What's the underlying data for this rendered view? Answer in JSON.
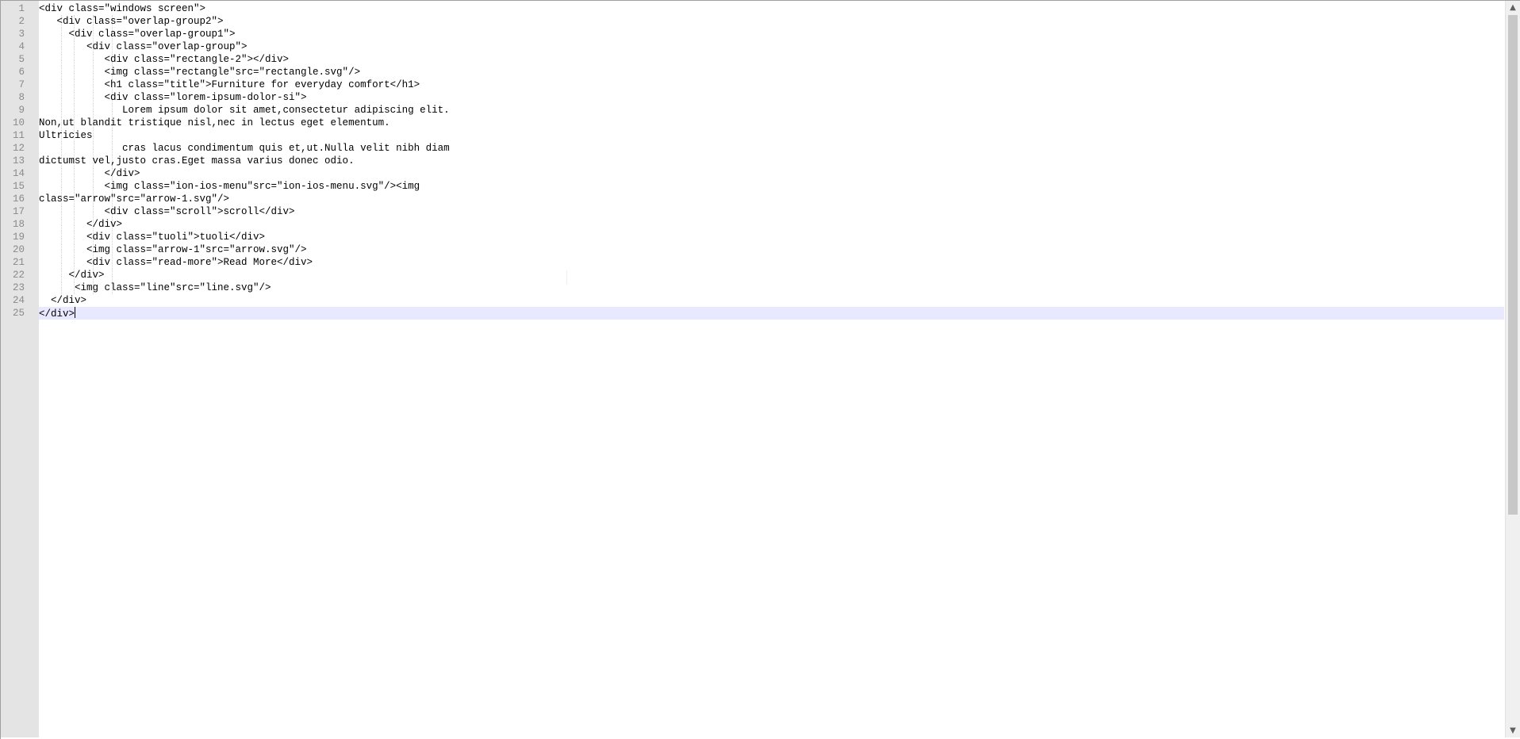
{
  "editor": {
    "line_numbers": [
      "1",
      "2",
      "3",
      "4",
      "5",
      "6",
      "7",
      "8",
      "9",
      "10",
      "11",
      "12",
      "13",
      "14",
      "15",
      "16",
      "17",
      "18",
      "19",
      "20",
      "21",
      "22",
      "23",
      "24",
      "25"
    ],
    "lines": [
      "<div class=\"windows screen\">",
      "   <div class=\"overlap-group2\">",
      "     <div class=\"overlap-group1\">",
      "        <div class=\"overlap-group\">",
      "           <div class=\"rectangle-2\"></div>",
      "           <img class=\"rectangle\"src=\"rectangle.svg\"/>",
      "           <h1 class=\"title\">Furniture for everyday comfort</h1>",
      "           <div class=\"lorem-ipsum-dolor-si\">",
      "              Lorem ipsum dolor sit amet,consectetur adipiscing elit.",
      "Non,ut blandit tristique nisl,nec in lectus eget elementum.",
      "Ultricies",
      "              cras lacus condimentum quis et,ut.Nulla velit nibh diam",
      "dictumst vel,justo cras.Eget massa varius donec odio.",
      "           </div>",
      "           <img class=\"ion-ios-menu\"src=\"ion-ios-menu.svg\"/><img",
      "class=\"arrow\"src=\"arrow-1.svg\"/>",
      "           <div class=\"scroll\">scroll</div>",
      "        </div>",
      "        <div class=\"tuoli\">tuoli</div>",
      "        <img class=\"arrow-1\"src=\"arrow.svg\"/>",
      "        <div class=\"read-more\">Read More</div>",
      "     </div>",
      "      <img class=\"line\"src=\"line.svg\"/>",
      "  </div>",
      "</div>"
    ],
    "current_line": 25,
    "colors": {
      "gutter_bg": "#e4e4e4",
      "line_number": "#8a8a8a",
      "current_line_bg": "#e8e8ff",
      "text": "#000000"
    }
  },
  "scrollbar": {
    "up_arrow_icon": "chevron-up-icon",
    "down_arrow_icon": "chevron-down-icon"
  }
}
